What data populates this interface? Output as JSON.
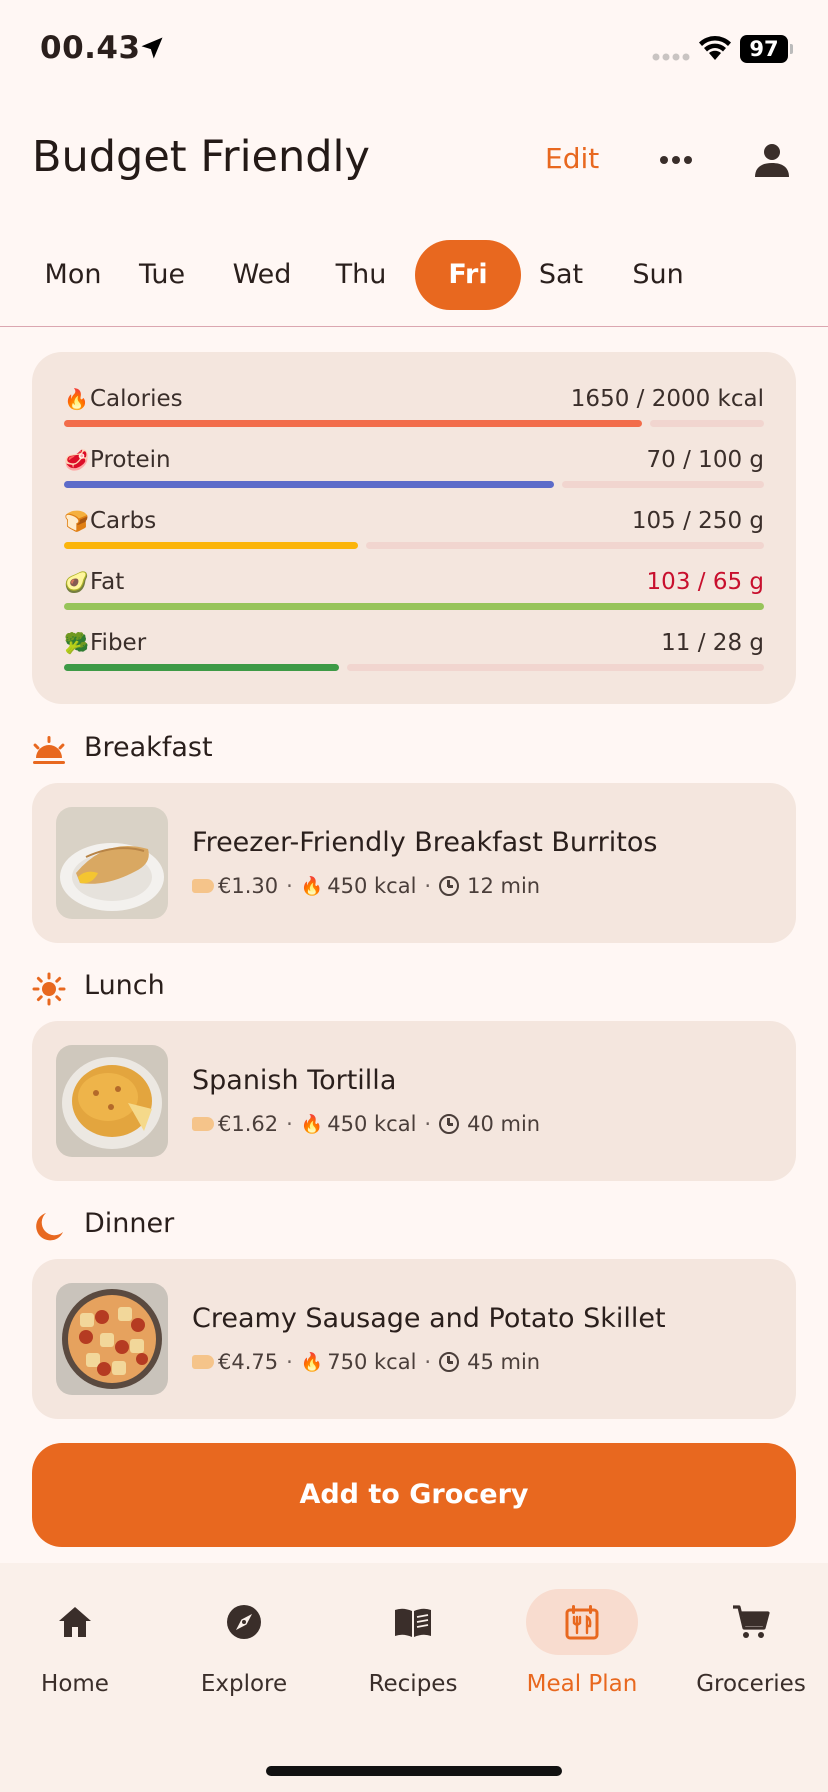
{
  "status_bar": {
    "time": "00.43",
    "battery": "97"
  },
  "header": {
    "title": "Budget Friendly",
    "edit_label": "Edit"
  },
  "days": [
    {
      "label": "Mon",
      "active": false
    },
    {
      "label": "Tue",
      "active": false
    },
    {
      "label": "Wed",
      "active": false
    },
    {
      "label": "Thu",
      "active": false
    },
    {
      "label": "Fri",
      "active": true
    },
    {
      "label": "Sat",
      "active": false
    },
    {
      "label": "Sun",
      "active": false
    }
  ],
  "nutrition": [
    {
      "emoji": "🔥",
      "label": "Calories",
      "value": "1650 / 2000 kcal",
      "fraction": 0.825,
      "color": "#f26d4b",
      "over": false
    },
    {
      "emoji": "🥩",
      "label": "Protein",
      "value": "70 / 100 g",
      "fraction": 0.7,
      "color": "#5c6bc9",
      "over": false
    },
    {
      "emoji": "🍞",
      "label": "Carbs",
      "value": "105 / 250 g",
      "fraction": 0.42,
      "color": "#fbb50b",
      "over": false
    },
    {
      "emoji": "🥑",
      "label": "Fat",
      "value": "103 / 65 g",
      "fraction": 1.0,
      "color": "#97c45a",
      "over": true
    },
    {
      "emoji": "🥦",
      "label": "Fiber",
      "value": "11 / 28 g",
      "fraction": 0.393,
      "color": "#3d9a46",
      "over": false
    }
  ],
  "meals": [
    {
      "section": "Breakfast",
      "name": "Freezer-Friendly Breakfast Burritos",
      "price": "€1.30",
      "kcal": "450 kcal",
      "time": "12 min"
    },
    {
      "section": "Lunch",
      "name": "Spanish Tortilla",
      "price": "€1.62",
      "kcal": "450 kcal",
      "time": "40 min"
    },
    {
      "section": "Dinner",
      "name": "Creamy Sausage and Potato Skillet",
      "price": "€4.75",
      "kcal": "750 kcal",
      "time": "45 min"
    }
  ],
  "cta_label": "Add to Grocery",
  "tab_bar": [
    {
      "label": "Home",
      "icon": "home-icon",
      "active": false
    },
    {
      "label": "Explore",
      "icon": "compass-icon",
      "active": false
    },
    {
      "label": "Recipes",
      "icon": "book-icon",
      "active": false
    },
    {
      "label": "Meal Plan",
      "icon": "calendar-icon",
      "active": true
    },
    {
      "label": "Groceries",
      "icon": "cart-icon",
      "active": false
    }
  ],
  "colors": {
    "accent": "#e8681f",
    "card": "#f4e6de",
    "background": "#fff7f4",
    "over_limit": "#c8102e"
  }
}
